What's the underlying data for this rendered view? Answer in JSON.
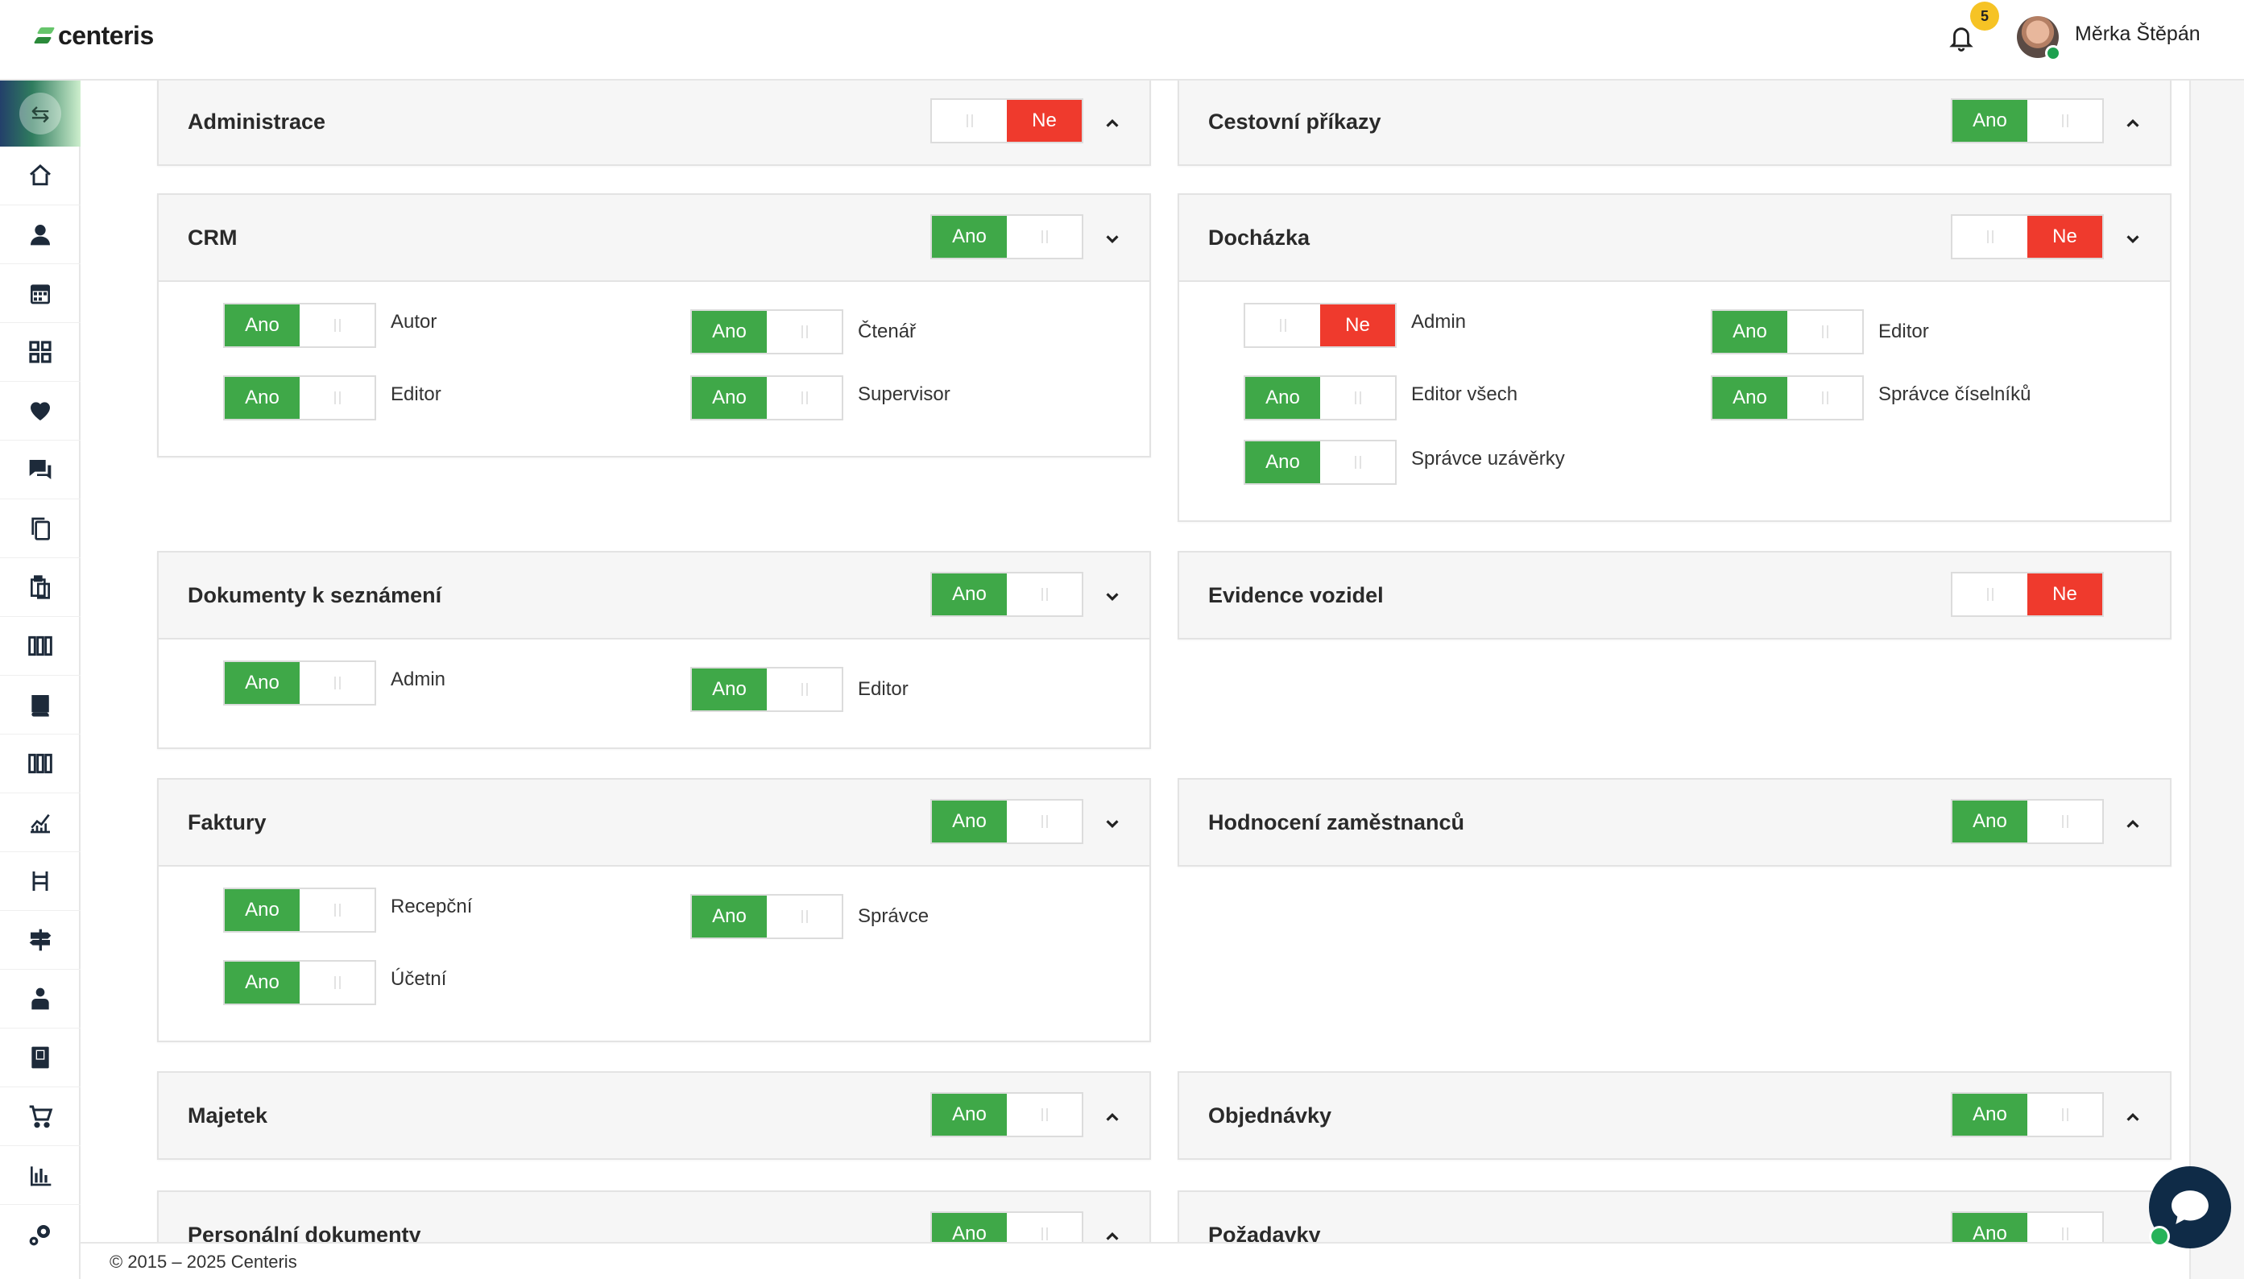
{
  "app": {
    "logo": "centeris"
  },
  "header": {
    "notification_count": "5",
    "user_name": "Měrka Štěpán"
  },
  "sidebar": {
    "toggle_icon": "swap-arrows-icon",
    "items": [
      "home-icon",
      "user-icon",
      "calendar-icon",
      "grid-icon",
      "heart-icon",
      "chat-icon",
      "copy-icon",
      "clipboard-icon",
      "columns-icon",
      "book-icon",
      "columns-icon",
      "chart-line-icon",
      "furniture-icon",
      "signpost-icon",
      "employee-icon",
      "book-bookmark-icon",
      "cart-icon",
      "bar-chart-icon",
      "settings-icon"
    ]
  },
  "labels": {
    "yes": "Ano",
    "no": "Ne"
  },
  "modules": [
    {
      "title": "Administrace",
      "value": "no",
      "expanded": false,
      "permissions": []
    },
    {
      "title": "Cestovní příkazy",
      "value": "yes",
      "expanded": false,
      "permissions": []
    },
    {
      "title": "CRM",
      "value": "yes",
      "expanded": true,
      "permissions": [
        {
          "label": "Autor",
          "value": "yes"
        },
        {
          "label": "Čtenář",
          "value": "yes"
        },
        {
          "label": "Editor",
          "value": "yes"
        },
        {
          "label": "Supervisor",
          "value": "yes"
        }
      ]
    },
    {
      "title": "Docházka",
      "value": "no",
      "expanded": true,
      "permissions": [
        {
          "label": "Admin",
          "value": "no"
        },
        {
          "label": "Editor",
          "value": "yes"
        },
        {
          "label": "Editor všech",
          "value": "yes"
        },
        {
          "label": "Správce číselníků",
          "value": "yes"
        },
        {
          "label": "Správce uzávěrky",
          "value": "yes"
        }
      ]
    },
    {
      "title": "Dokumenty k seznámení",
      "value": "yes",
      "expanded": true,
      "permissions": [
        {
          "label": "Admin",
          "value": "yes"
        },
        {
          "label": "Editor",
          "value": "yes"
        }
      ]
    },
    {
      "title": "Evidence vozidel",
      "value": "no",
      "expanded": false,
      "permissions": []
    },
    {
      "title": "Faktury",
      "value": "yes",
      "expanded": true,
      "permissions": [
        {
          "label": "Recepční",
          "value": "yes"
        },
        {
          "label": "Správce",
          "value": "yes"
        },
        {
          "label": "Účetní",
          "value": "yes"
        }
      ]
    },
    {
      "title": "Hodnocení zaměstnanců",
      "value": "yes",
      "expanded": false,
      "permissions": []
    },
    {
      "title": "Majetek",
      "value": "yes",
      "expanded": false,
      "permissions": []
    },
    {
      "title": "Objednávky",
      "value": "yes",
      "expanded": false,
      "permissions": []
    },
    {
      "title": "Personální dokumenty",
      "value": "yes",
      "expanded": false,
      "permissions": []
    },
    {
      "title": "Požadavky",
      "value": "yes",
      "expanded": false,
      "permissions": []
    }
  ],
  "footer": {
    "copyright": "© 2015 – 2025 Centeris"
  },
  "colors": {
    "yes": "#3fa848",
    "no": "#ef3a2d",
    "badge": "#f6c325",
    "chat": "#0f2b47"
  }
}
